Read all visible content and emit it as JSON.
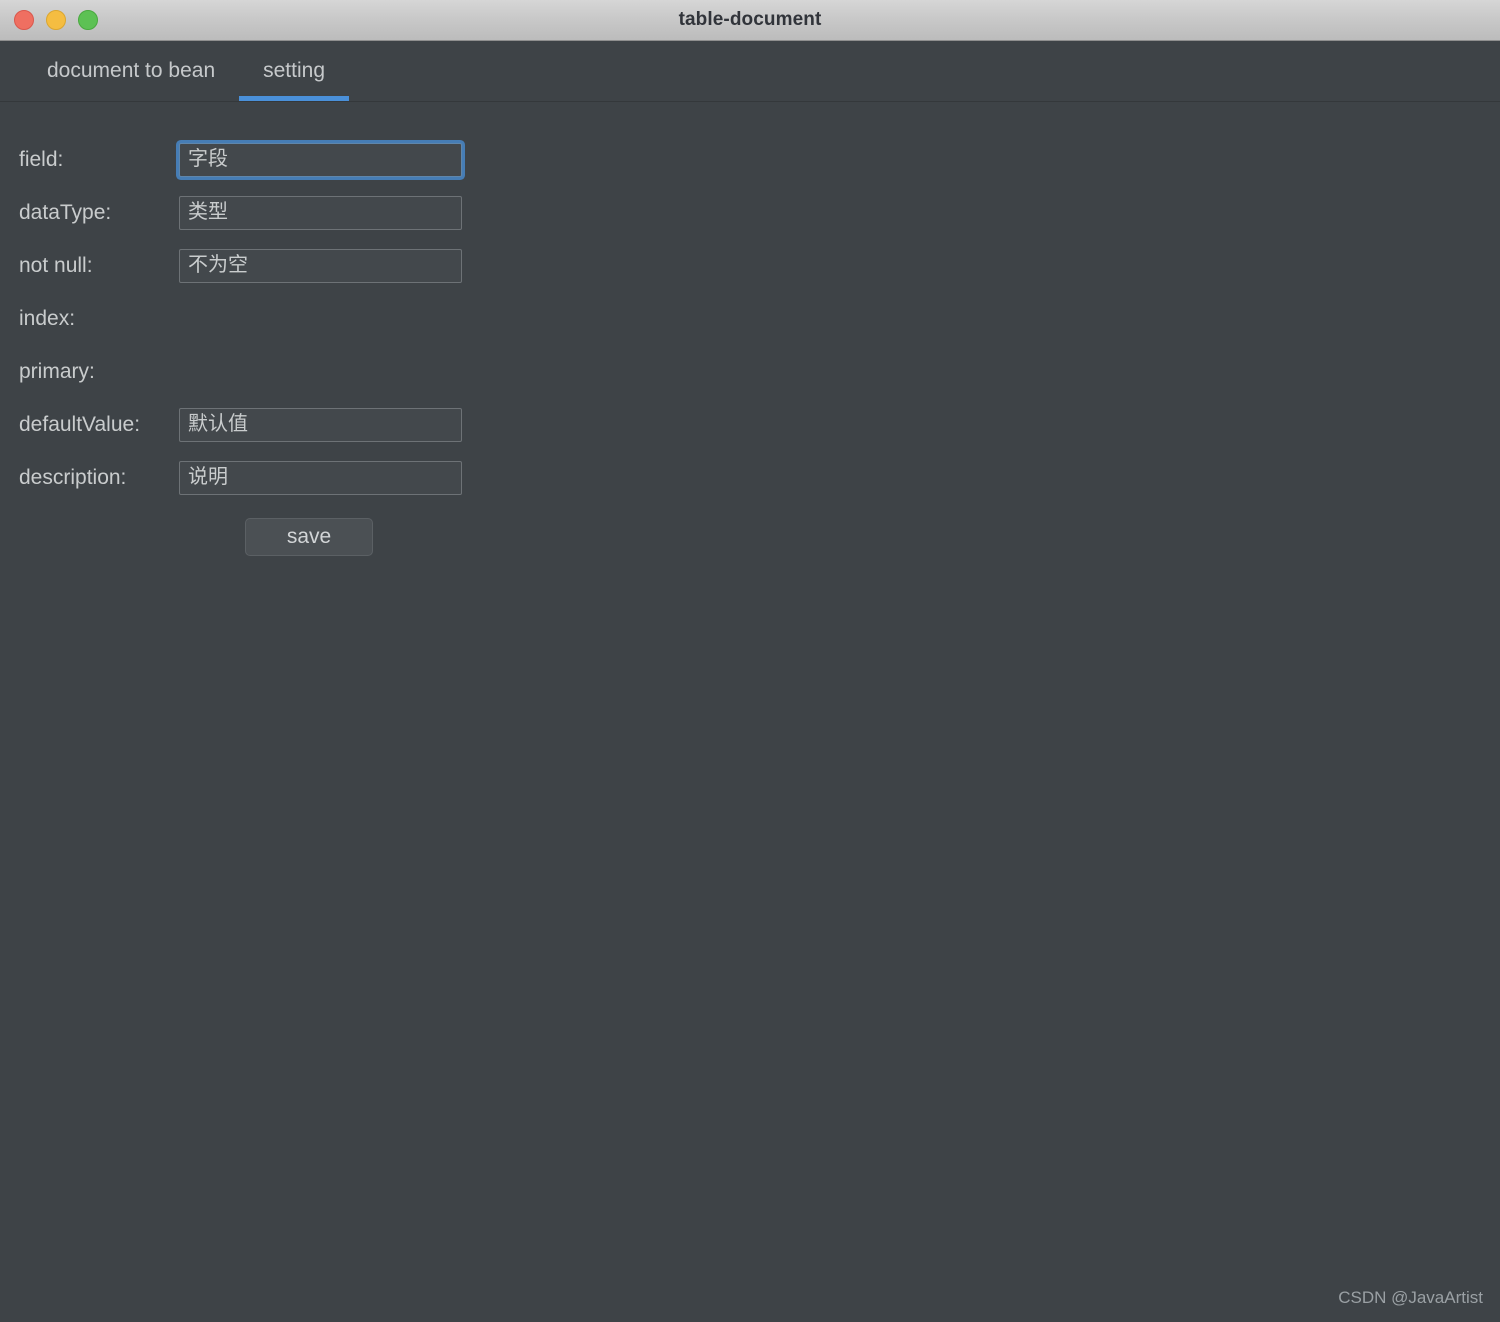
{
  "window": {
    "title": "table-document",
    "controls": [
      {
        "name": "close",
        "color": "#ef6f61"
      },
      {
        "name": "minimize",
        "color": "#f5bd41"
      },
      {
        "name": "maximize",
        "color": "#5dc154"
      }
    ]
  },
  "tabs": [
    {
      "label": "document to bean",
      "active": false
    },
    {
      "label": "setting",
      "active": true
    }
  ],
  "form": {
    "rows": [
      {
        "label": "field:",
        "value": "字段",
        "has_input": true,
        "focused": true
      },
      {
        "label": "dataType:",
        "value": "类型",
        "has_input": true,
        "focused": false
      },
      {
        "label": "not null:",
        "value": "不为空",
        "has_input": true,
        "focused": false
      },
      {
        "label": "index:",
        "value": "",
        "has_input": false,
        "focused": false
      },
      {
        "label": "primary:",
        "value": "",
        "has_input": false,
        "focused": false
      },
      {
        "label": "defaultValue:",
        "value": "默认值",
        "has_input": true,
        "focused": false
      },
      {
        "label": "description:",
        "value": "说明",
        "has_input": true,
        "focused": false
      }
    ],
    "save_label": "save"
  },
  "watermark": "CSDN @JavaArtist",
  "colors": {
    "background": "#3e4347",
    "accent": "#4a90d9",
    "input_background": "#43484c",
    "input_border": "#6d7276",
    "text": "#c9cccd",
    "titlebar": "#c9c9c9"
  }
}
